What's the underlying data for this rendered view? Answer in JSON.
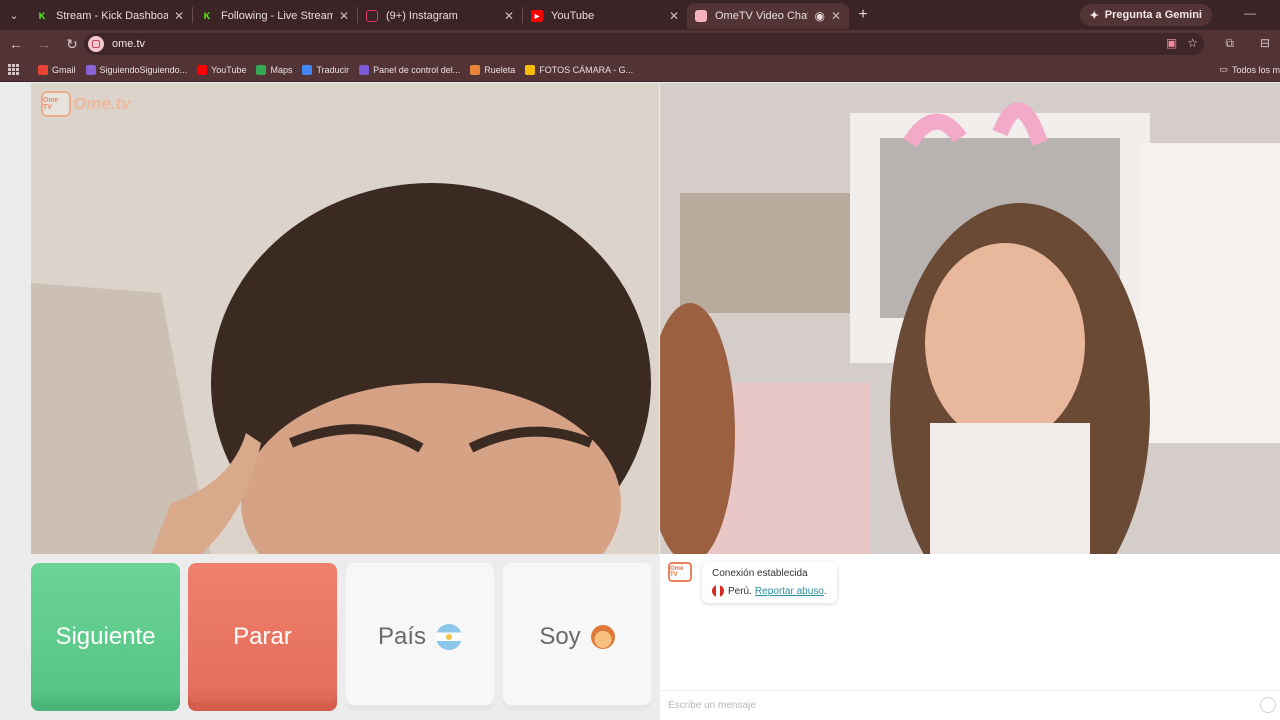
{
  "browser": {
    "tabs": [
      {
        "title": "Stream - Kick Dashboard",
        "icon": "kick-icon",
        "color": "#53fc18",
        "active": false
      },
      {
        "title": "Following - Live Streams on Kick",
        "icon": "kick-icon",
        "color": "#53fc18",
        "active": false
      },
      {
        "title": "(9+) Instagram",
        "icon": "instagram-icon",
        "color": "#e1306c",
        "active": false
      },
      {
        "title": "YouTube",
        "icon": "youtube-icon",
        "color": "#ff0000",
        "active": false
      },
      {
        "title": "OmeTV Video Chat — Ome",
        "icon": "ometv-icon",
        "color": "#f07a5a",
        "active": true
      }
    ],
    "gemini_label": "Pregunta a Gemini",
    "url": "ome.tv",
    "bookmarks": [
      {
        "label": "Gmail",
        "color": "#ea4335"
      },
      {
        "label": "SiguiendoSiguiendo...",
        "color": "#8a63d2"
      },
      {
        "label": "YouTube",
        "color": "#ff0000"
      },
      {
        "label": "Maps",
        "color": "#34a853"
      },
      {
        "label": "Traducir",
        "color": "#4285f4"
      },
      {
        "label": "Panel de control del...",
        "color": "#7b5cd6"
      },
      {
        "label": "Rueleta",
        "color": "#e8833a"
      },
      {
        "label": "FOTOS CÁMARA - G...",
        "color": "#fbbc04"
      }
    ],
    "all_bookmarks_label": "Todos los m"
  },
  "page": {
    "logo_text": "Ome.tv",
    "logo_badge": "Ome TV",
    "buttons": {
      "next": "Siguiente",
      "stop": "Parar",
      "country": "País",
      "soy": "Soy"
    },
    "chat": {
      "status": "Conexión establecida",
      "country": "Perú.",
      "report": "Reportar abuso",
      "report_suffix": ".",
      "placeholder": "Escribe un mensaje"
    }
  }
}
